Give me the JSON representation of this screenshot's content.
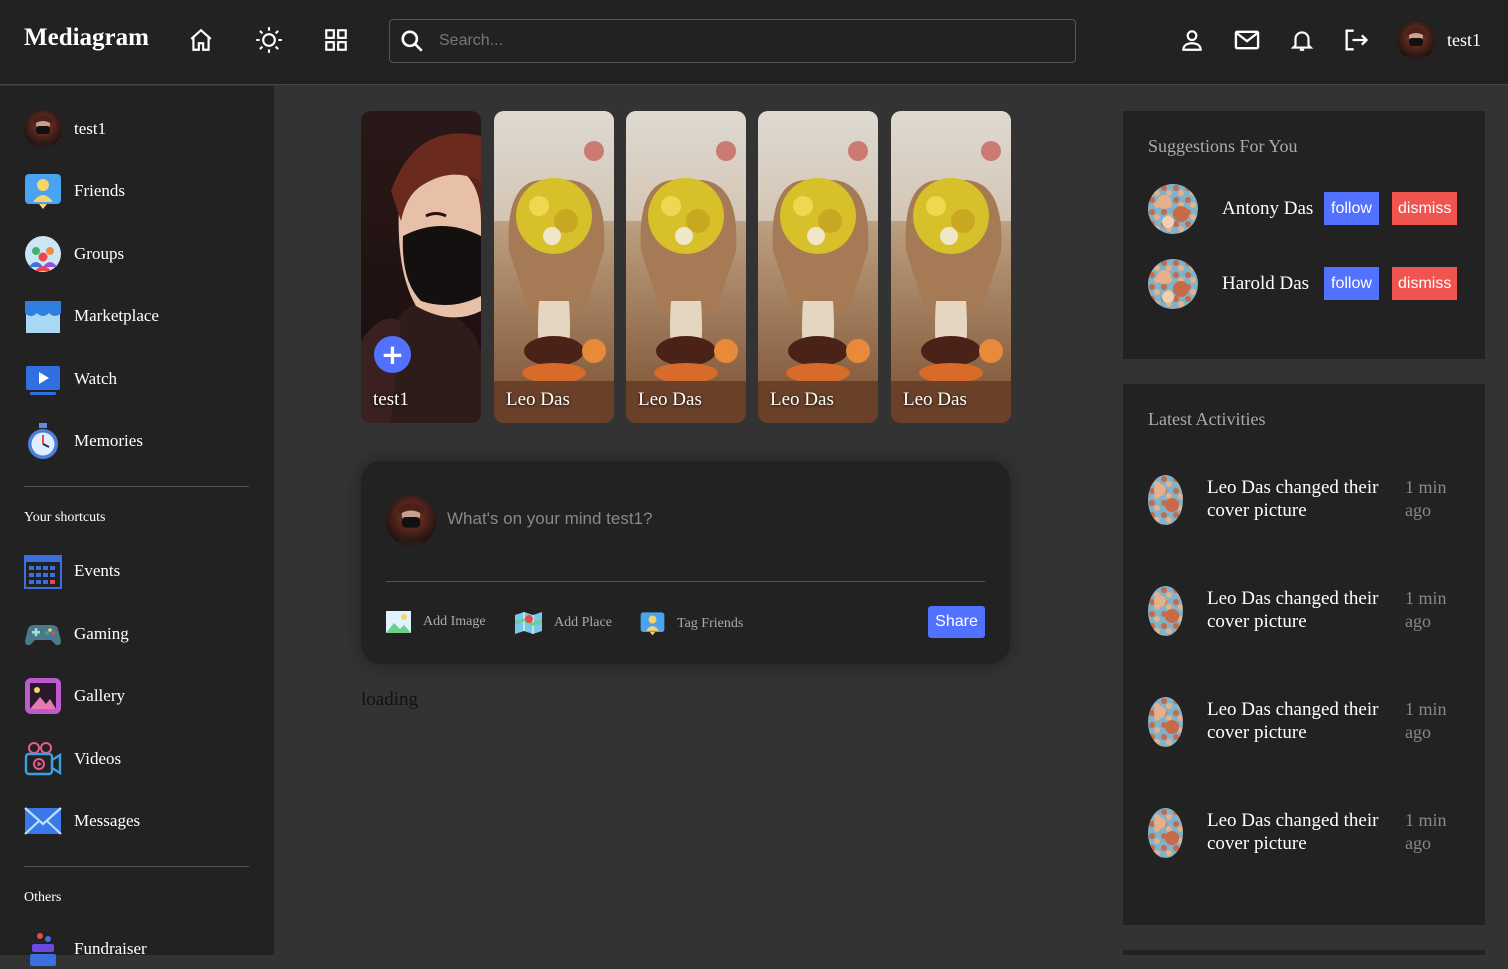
{
  "navbar": {
    "logo": "Mediagram",
    "search_placeholder": "Search...",
    "username": "test1"
  },
  "sidebar": {
    "items": [
      {
        "label": "test1"
      },
      {
        "label": "Friends"
      },
      {
        "label": "Groups"
      },
      {
        "label": "Marketplace"
      },
      {
        "label": "Watch"
      },
      {
        "label": "Memories"
      }
    ],
    "shortcuts_title": "Your shortcuts",
    "shortcuts": [
      {
        "label": "Events"
      },
      {
        "label": "Gaming"
      },
      {
        "label": "Gallery"
      },
      {
        "label": "Videos"
      },
      {
        "label": "Messages"
      }
    ],
    "others_title": "Others",
    "others": [
      {
        "label": "Fundraiser"
      }
    ]
  },
  "stories": [
    {
      "name": "test1"
    },
    {
      "name": "Leo Das"
    },
    {
      "name": "Leo Das"
    },
    {
      "name": "Leo Das"
    },
    {
      "name": "Leo Das"
    }
  ],
  "share": {
    "placeholder": "What's on your mind test1?",
    "add_image": "Add Image",
    "add_place": "Add Place",
    "tag_friends": "Tag Friends",
    "share_label": "Share"
  },
  "feed": {
    "loading": "loading"
  },
  "suggestions": {
    "title": "Suggestions For You",
    "people": [
      {
        "name": "Antony Das",
        "follow": "follow",
        "dismiss": "dismiss"
      },
      {
        "name": "Harold Das",
        "follow": "follow",
        "dismiss": "dismiss"
      }
    ]
  },
  "activities": {
    "title": "Latest Activities",
    "items": [
      {
        "text": "Leo Das changed their cover picture",
        "time": "1 min ago"
      },
      {
        "text": "Leo Das changed their cover picture",
        "time": "1 min ago"
      },
      {
        "text": "Leo Das changed their cover picture",
        "time": "1 min ago"
      },
      {
        "text": "Leo Das changed their cover picture",
        "time": "1 min ago"
      }
    ]
  },
  "colors": {
    "accent": "#5271ff",
    "danger": "#f0544f",
    "panel": "#222222",
    "background": "#333333"
  }
}
